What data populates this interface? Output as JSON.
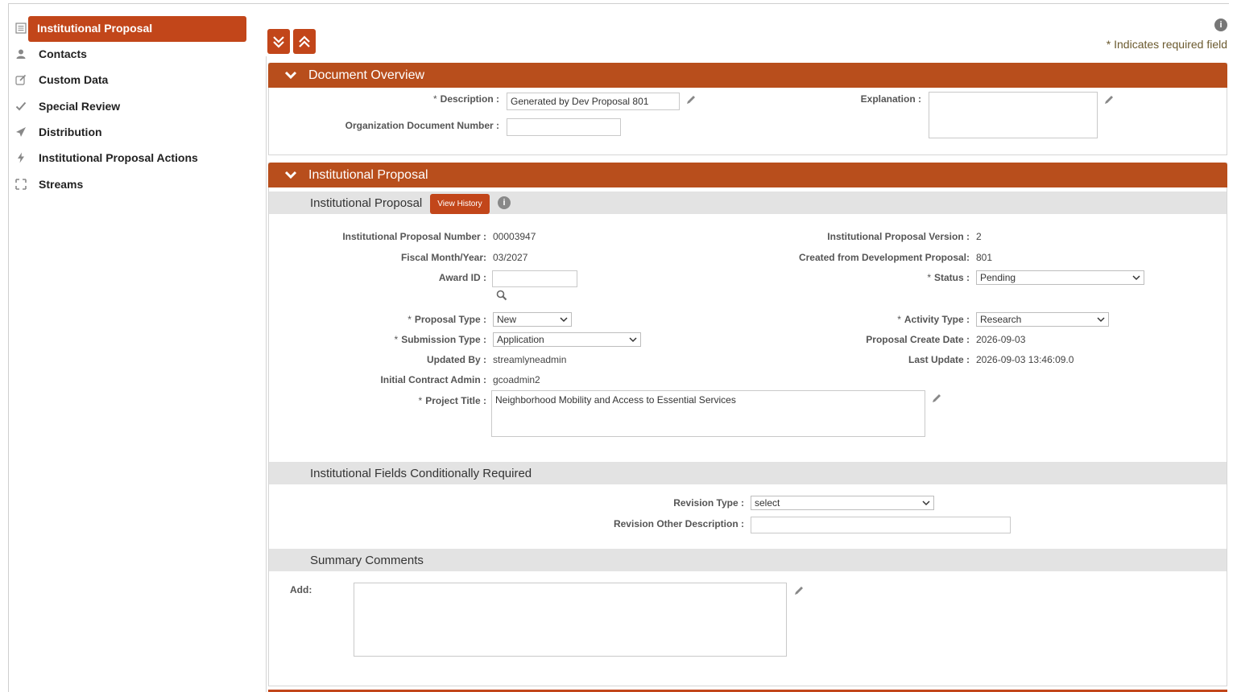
{
  "sidebar": {
    "items": [
      {
        "label": "Institutional Proposal",
        "icon": "document-list-icon",
        "active": true
      },
      {
        "label": "Contacts",
        "icon": "user-icon"
      },
      {
        "label": "Custom Data",
        "icon": "edit-square-icon"
      },
      {
        "label": "Special Review",
        "icon": "checkmark-icon"
      },
      {
        "label": "Distribution",
        "icon": "paper-plane-icon"
      },
      {
        "label": "Institutional Proposal Actions",
        "icon": "lightning-icon"
      },
      {
        "label": "Streams",
        "icon": "expand-arrows-icon"
      }
    ]
  },
  "header": {
    "required_note": "* Indicates required field",
    "info": "i"
  },
  "document_overview": {
    "title": "Document Overview",
    "description_label": "Description :",
    "description_value": "Generated by Dev Proposal 801",
    "org_doc_label": "Organization Document Number :",
    "org_doc_value": "",
    "explanation_label": "Explanation :",
    "explanation_value": ""
  },
  "institutional_proposal": {
    "title": "Institutional Proposal",
    "sub_title": "Institutional Proposal",
    "view_history": "View History",
    "info": "i",
    "fields": {
      "number_label": "Institutional Proposal Number :",
      "number_value": "00003947",
      "version_label": "Institutional Proposal Version :",
      "version_value": "2",
      "fiscal_label": "Fiscal Month/Year:",
      "fiscal_value": "03/2027",
      "created_from_label": "Created from Development Proposal:",
      "created_from_value": "801",
      "award_id_label": "Award ID :",
      "award_id_value": "",
      "status_label": "Status :",
      "status_value": "Pending",
      "proposal_type_label": "Proposal Type :",
      "proposal_type_value": "New",
      "activity_type_label": "Activity Type :",
      "activity_type_value": "Research",
      "submission_type_label": "Submission Type :",
      "submission_type_value": "Application",
      "create_date_label": "Proposal Create Date :",
      "create_date_value": "2026-09-03",
      "updated_by_label": "Updated By :",
      "updated_by_value": "streamlyneadmin",
      "last_update_label": "Last Update :",
      "last_update_value": "2026-09-03 13:46:09.0",
      "contract_admin_label": "Initial Contract Admin :",
      "contract_admin_value": "gcoadmin2",
      "project_title_label": "Project Title :",
      "project_title_value": "Neighborhood Mobility and Access to Essential Services"
    }
  },
  "conditional": {
    "title": "Institutional Fields Conditionally Required",
    "revision_type_label": "Revision Type :",
    "revision_type_value": "select",
    "revision_other_label": "Revision Other Description :",
    "revision_other_value": ""
  },
  "summary": {
    "title": "Summary Comments",
    "add_label": "Add:",
    "add_value": ""
  },
  "colors": {
    "accent": "#c2461a",
    "panel_header": "#b84e1c",
    "sub_header": "#e3e3e3"
  }
}
